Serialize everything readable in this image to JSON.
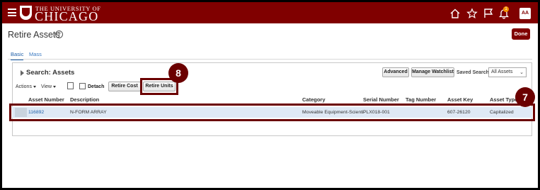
{
  "header": {
    "university_line": "THE UNIVERSITY OF",
    "university_name": "CHICAGO",
    "notification_count": "1",
    "avatar_initials": "AA",
    "icons": [
      "hamburger-icon",
      "home-icon",
      "star-icon",
      "flag-icon",
      "bell-icon"
    ]
  },
  "page": {
    "title": "Retire Assets",
    "done_label": "Done"
  },
  "tabs": [
    {
      "label": "Basic",
      "active": true
    },
    {
      "label": "Mass",
      "active": false
    }
  ],
  "search": {
    "title": "Search: Assets",
    "advanced_label": "Advanced",
    "manage_watchlist_label": "Manage Watchlist",
    "saved_search_label": "Saved Search",
    "saved_search_value": "All Assets"
  },
  "toolbar": {
    "actions_label": "Actions",
    "view_label": "View",
    "detach_label": "Detach",
    "retire_cost_label": "Retire Cost",
    "retire_units_label": "Retire Units"
  },
  "table": {
    "columns": [
      "Asset Number",
      "Description",
      "Category",
      "Serial Number",
      "Tag Number",
      "Asset Key",
      "Asset Type"
    ],
    "rows": [
      {
        "asset_number": "116892",
        "description": "N-FORM ARRAY",
        "category": "Moveable Equipment-Scienti",
        "serial_number": "PLX018-001",
        "tag_number": "",
        "asset_key": "607-26120",
        "asset_type": "Capitalized"
      }
    ]
  },
  "callouts": [
    {
      "label": "8",
      "target": "retire-units-button"
    },
    {
      "label": "7",
      "target": "asset-table-row"
    }
  ],
  "colors": {
    "brand": "#800000",
    "callout": "#6b0000",
    "link": "#1f5fa8",
    "row_selected": "#dfe9f5"
  }
}
